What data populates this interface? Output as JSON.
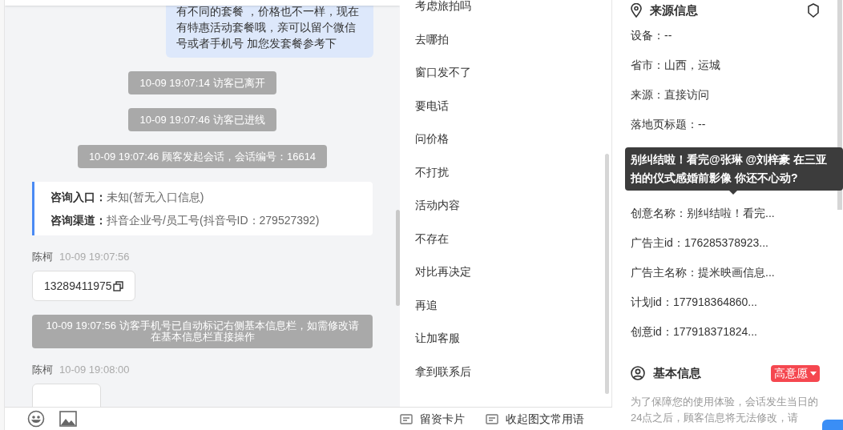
{
  "chat": {
    "messages": [
      {
        "kind": "bubble",
        "text": "有不同的套餐 ，价格也不一样，现在有特惠活动套餐哦，亲可以留个微信号或者手机号 加您发套餐参考下"
      },
      {
        "kind": "system",
        "text": "10-09 19:07:14 访客已离开"
      },
      {
        "kind": "system",
        "text": "10-09 19:07:46 访客已进线"
      },
      {
        "kind": "system",
        "text": "10-09 19:07:46 顾客发起会话，会话编号：16614"
      },
      {
        "kind": "info",
        "rows": [
          {
            "label": "咨询入口：",
            "value": "未知(暂无入口信息)"
          },
          {
            "label": "咨询渠道：",
            "value": "抖音企业号/员工号(抖音号ID：279527392)"
          }
        ]
      },
      {
        "kind": "card",
        "sender": "陈柯",
        "time": "10-09 19:07:56",
        "text": "13289411975"
      },
      {
        "kind": "notice",
        "text": "10-09 19:07:56 访客手机号已自动标记右侧基本信息栏，如需修改请在基本信息栏直接操作"
      },
      {
        "kind": "card",
        "sender": "陈柯",
        "time": "10-09 19:08:00"
      }
    ]
  },
  "toolbar": {
    "buttons": [
      "留资卡片",
      "收起图文常用语"
    ]
  },
  "quick_replies": [
    "考虑旅拍吗",
    "去哪拍",
    "窗口发不了",
    "要电话",
    "问价格",
    "不打扰",
    "活动内容",
    "不存在",
    "对比再决定",
    "再追",
    "让加客服",
    "拿到联系后"
  ],
  "source_info": {
    "title": "来源信息",
    "rows": [
      {
        "kind": "field",
        "text": "设备：--"
      },
      {
        "kind": "field",
        "text": "省市：山西，运城"
      },
      {
        "kind": "field",
        "text": "来源：直接访问"
      },
      {
        "kind": "field",
        "text": "落地页标题：--"
      },
      {
        "kind": "tooltip",
        "text": "别纠结啦！看完@张琳 @刘梓豪 在三亚拍的仪式感婚前影像 你还不心动?"
      },
      {
        "kind": "field",
        "text": "创意名称：别纠结啦！看完..."
      },
      {
        "kind": "field",
        "text": "广告主id：176285378923..."
      },
      {
        "kind": "field",
        "text": "广告主名称：提米映画信息..."
      },
      {
        "kind": "field",
        "text": "计划id：177918364860..."
      },
      {
        "kind": "field",
        "text": "创意id：177918371824..."
      }
    ]
  },
  "basic_info": {
    "title": "基本信息",
    "intent": "高意愿",
    "notice": "为了保障您的使用体验，会话发生当日的24点之后，顾客信息将无法修改，请"
  }
}
